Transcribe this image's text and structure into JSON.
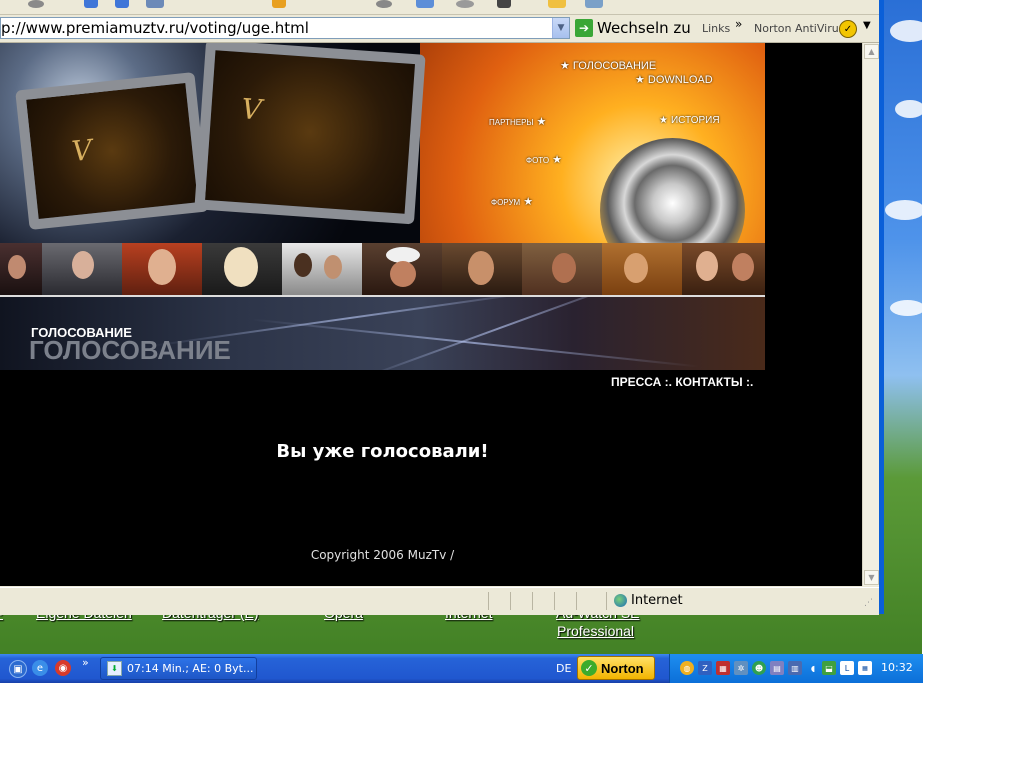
{
  "browser": {
    "address": "p://www.premiamuztv.ru/voting/uge.html",
    "go_label": "Wechseln zu",
    "links_label": "Links",
    "links_chevron": "»",
    "norton_toolbar_label": "Norton AntiVirus",
    "status_zone": "Internet"
  },
  "banner": {
    "menu": {
      "voting": "ГОЛОСОВАНИЕ",
      "download": "DOWNLOAD",
      "partners": "ПАРТНЕРЫ",
      "history": "ИСТОРИЯ",
      "photo": "ФОТО",
      "forum": "ФОРУМ"
    },
    "section_title_small": "ГОЛОСОВАНИЕ",
    "section_title_large": "ГОЛОСОВАНИЕ"
  },
  "page": {
    "press": "ПРЕССА :.",
    "contacts": "КОНТАКТЫ :.",
    "message": "Вы уже голосовали!",
    "copyright": "Copyright 2006 MuzTv /"
  },
  "desktop": {
    "icons": [
      "Eigene Dateien",
      "Datenträger (E)",
      "Opera",
      "Internet",
      "Ad-Watch SE",
      "Professional"
    ]
  },
  "taskbar": {
    "ql_chevron": "»",
    "task_label": "07:14 Min.; AE: 0 Byt...",
    "lang": "DE",
    "norton_label": "Norton",
    "clock": "10:32"
  },
  "colors": {
    "taskbar_blue": "#2057cf",
    "tray_blue": "#0c6fd8",
    "norton_yellow": "#f2b400",
    "page_bg": "#000000"
  }
}
